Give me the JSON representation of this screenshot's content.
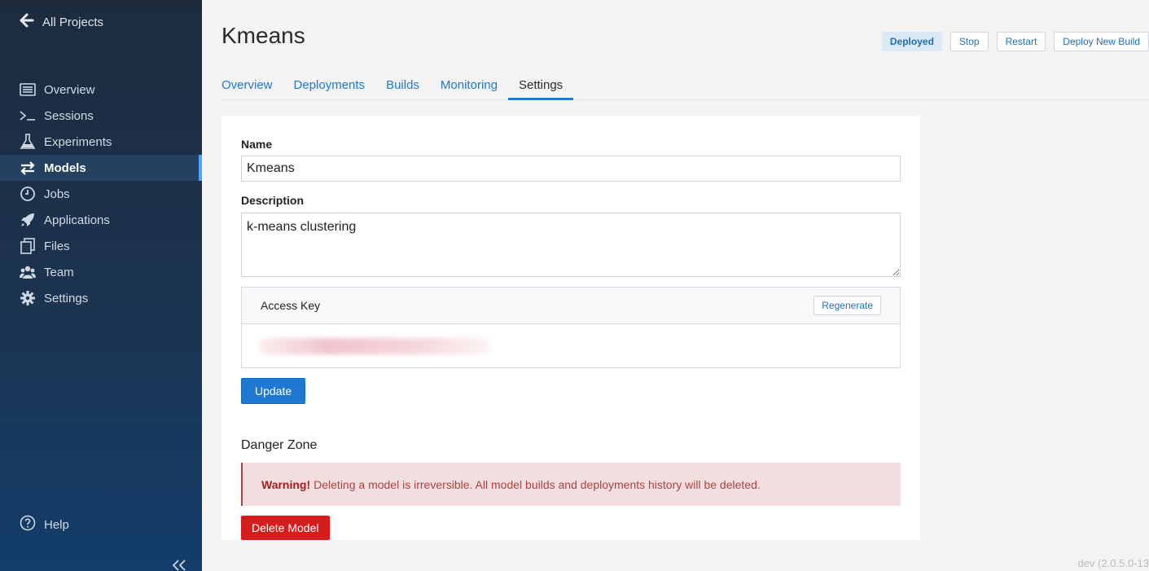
{
  "sidebar": {
    "back_label": "All Projects",
    "items": [
      {
        "label": "Overview",
        "icon": "overview-icon"
      },
      {
        "label": "Sessions",
        "icon": "terminal-icon"
      },
      {
        "label": "Experiments",
        "icon": "flask-icon"
      },
      {
        "label": "Models",
        "icon": "arrows-exchange-icon",
        "active": true
      },
      {
        "label": "Jobs",
        "icon": "clock-icon"
      },
      {
        "label": "Applications",
        "icon": "rocket-icon"
      },
      {
        "label": "Files",
        "icon": "files-icon"
      },
      {
        "label": "Team",
        "icon": "team-icon"
      },
      {
        "label": "Settings",
        "icon": "gear-icon"
      }
    ],
    "help_label": "Help"
  },
  "header": {
    "title": "Kmeans",
    "status": "Deployed",
    "actions": {
      "stop": "Stop",
      "restart": "Restart",
      "deploy": "Deploy New Build"
    }
  },
  "tabs": [
    "Overview",
    "Deployments",
    "Builds",
    "Monitoring",
    "Settings"
  ],
  "active_tab": "Settings",
  "form": {
    "name_label": "Name",
    "name_value": "Kmeans",
    "description_label": "Description",
    "description_value": "k-means clustering",
    "access_key_title": "Access Key",
    "regenerate_label": "Regenerate",
    "update_label": "Update"
  },
  "danger": {
    "title": "Danger Zone",
    "warning_strong": "Warning!",
    "warning_text": "Deleting a model is irreversible. All model builds and deployments history will be deleted.",
    "delete_label": "Delete Model"
  },
  "footer": {
    "version": "dev (2.0.5.0-13"
  },
  "colors": {
    "accent": "#1f78d1",
    "danger": "#d51d1d",
    "sidebar_bg": "#1d2b3d"
  }
}
